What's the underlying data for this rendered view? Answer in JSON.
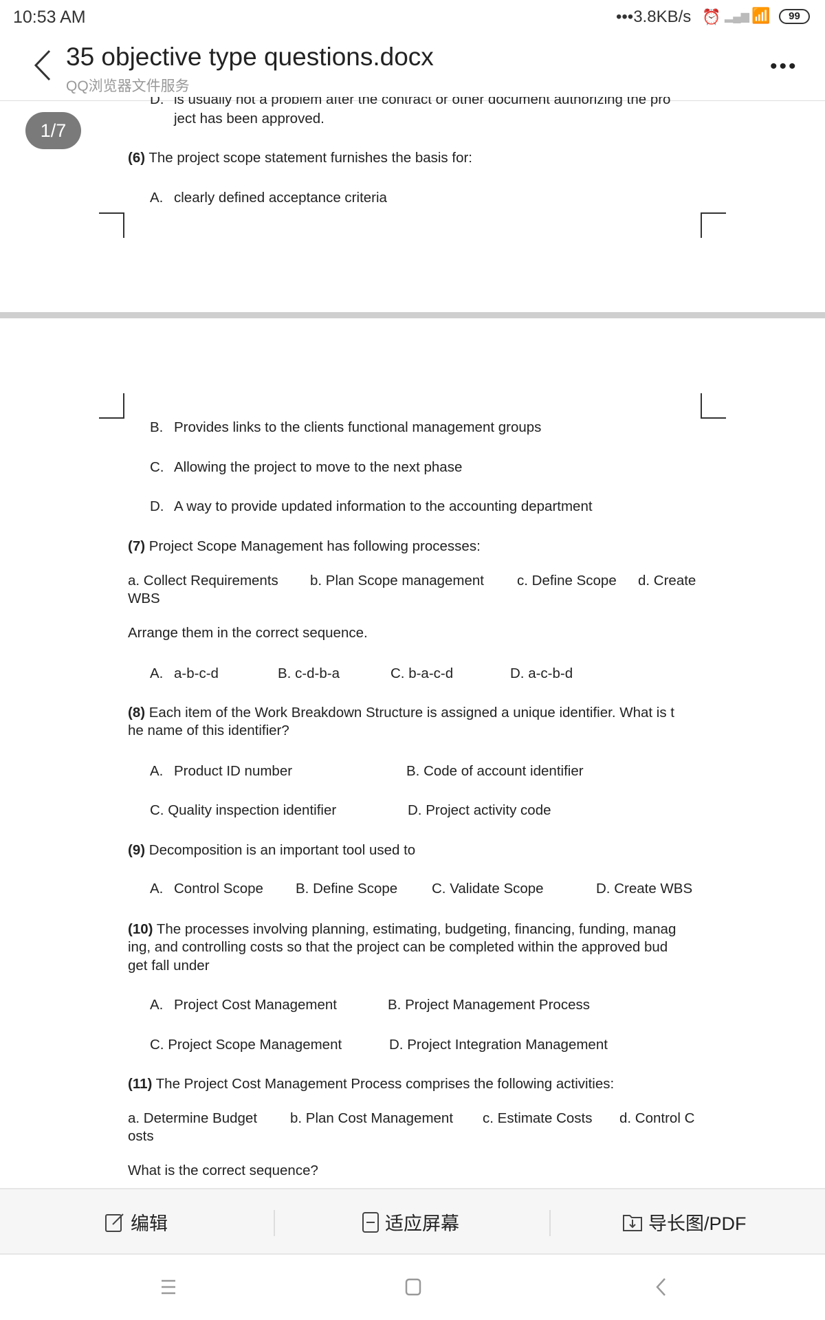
{
  "status": {
    "time": "10:53 AM",
    "speed": "•••3.8KB/s",
    "battery": "99"
  },
  "header": {
    "title": "35 objective type questions.docx",
    "subtitle": "QQ浏览器文件服务"
  },
  "page_indicator": "1/7",
  "doc": {
    "q5_d_label": "D.",
    "q5_d_line1": "is usually not a problem after the contract or other document authorizing the pro",
    "q5_d_line2": "ject has been approved.",
    "q6": {
      "num": "(6)",
      "text": " The project scope statement furnishes the basis for:",
      "a_label": "A.",
      "a": "clearly defined acceptance criteria",
      "b_label": "B.",
      "b": "Provides links to the clients functional management groups",
      "c_label": "C.",
      "c": "Allowing the project to move to the next phase",
      "d_label": "D.",
      "d": "A way to provide updated information to the accounting department"
    },
    "q7": {
      "num": "(7)",
      "text": " Project Scope Management has following processes:",
      "items": [
        "a. Collect Requirements",
        "b. Plan Scope management",
        "c. Define Scope",
        "d. Create"
      ],
      "items_wrap": "WBS",
      "instruction": "Arrange them in the correct sequence.",
      "a_label": "A.",
      "a": "a-b-c-d",
      "b": "B. c-d-b-a",
      "c": "C. b-a-c-d",
      "d": "D. a-c-b-d"
    },
    "q8": {
      "num": "(8)",
      "line1": " Each item of the Work Breakdown Structure is assigned a unique identifier. What is t",
      "line2": "he name of this identifier?",
      "a_label": "A.",
      "a": "Product ID number",
      "b": "B. Code of account identifier",
      "c": "C. Quality inspection identifier",
      "d": "D. Project activity code"
    },
    "q9": {
      "num": "(9)",
      "text": " Decomposition is an important tool used to",
      "a_label": "A.",
      "a": "Control Scope",
      "b": "B. Define Scope",
      "c": "C. Validate Scope",
      "d": "D. Create WBS"
    },
    "q10": {
      "num": "(10)",
      "line1": " The processes involving planning, estimating, budgeting, financing, funding, manag",
      "line2": "ing, and controlling costs so that the project can be completed within the approved bud",
      "line3": "get fall under",
      "a_label": "A.",
      "a": "Project Cost Management",
      "b": "B. Project Management Process",
      "c": "C. Project Scope Management",
      "d": "D. Project Integration Management"
    },
    "q11": {
      "num": "(11)",
      "text": " The Project Cost Management Process comprises the following activities:",
      "items": [
        "a. Determine Budget",
        "b. Plan Cost Management",
        "c. Estimate Costs",
        "d. Control C"
      ],
      "items_wrap": "osts",
      "question": "What is the correct sequence?"
    }
  },
  "toolbar": {
    "edit": "编辑",
    "fit": "适应屏幕",
    "export": "导长图/PDF"
  }
}
